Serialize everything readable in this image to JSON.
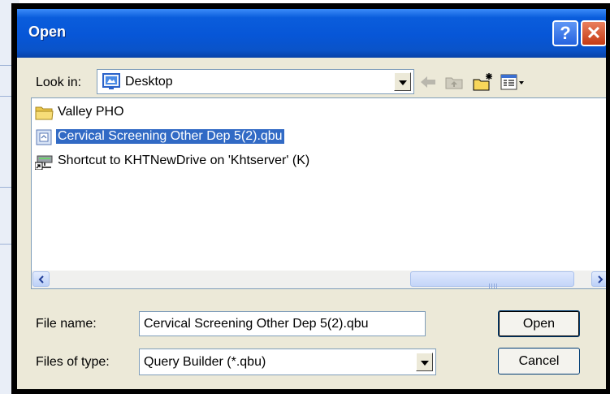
{
  "dialog": {
    "title": "Open",
    "help_glyph": "?",
    "close_glyph": "✕"
  },
  "look_in": {
    "label": "Look in:",
    "value": "Desktop",
    "icon": "desktop-icon"
  },
  "toolbar": {
    "icons": [
      "back-arrow-icon",
      "up-folder-icon",
      "new-folder-icon",
      "view-menu-icon"
    ]
  },
  "files": [
    {
      "name": "Valley PHO",
      "icon": "folder-icon",
      "selected": false
    },
    {
      "name": "Cervical Screening Other Dep 5(2).qbu",
      "icon": "qbu-file-icon",
      "selected": true
    },
    {
      "name": "Shortcut to KHTNewDrive on 'Khtserver' (K)",
      "icon": "network-drive-shortcut-icon",
      "selected": false
    }
  ],
  "file_name": {
    "label": "File name:",
    "value": "Cervical Screening Other Dep 5(2).qbu"
  },
  "file_type": {
    "label": "Files of type:",
    "value": "Query Builder (*.qbu)"
  },
  "buttons": {
    "open": "Open",
    "cancel": "Cancel"
  },
  "colors": {
    "title_bar": "#0756d7",
    "selection": "#316ac5",
    "dialog_face": "#ece9d8"
  }
}
